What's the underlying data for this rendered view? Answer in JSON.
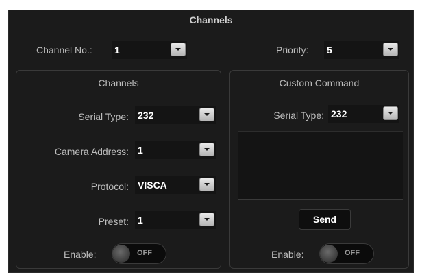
{
  "window": {
    "title": "Channels"
  },
  "top": {
    "channel_no": {
      "label": "Channel No.:",
      "value": "1"
    },
    "priority": {
      "label": "Priority:",
      "value": "5"
    }
  },
  "left_panel": {
    "title": "Channels",
    "serial_type": {
      "label": "Serial Type:",
      "value": "232"
    },
    "camera_address": {
      "label": "Camera Address:",
      "value": "1"
    },
    "protocol": {
      "label": "Protocol:",
      "value": "VISCA"
    },
    "preset": {
      "label": "Preset:",
      "value": "1"
    },
    "enable": {
      "label": "Enable:",
      "state": "OFF"
    }
  },
  "right_panel": {
    "title": "Custom Command",
    "serial_type": {
      "label": "Serial Type:",
      "value": "232"
    },
    "command_text": "",
    "send_label": "Send",
    "enable": {
      "label": "Enable:",
      "state": "OFF"
    }
  },
  "colors": {
    "background": "#1b1b1b",
    "field": "#141414",
    "text": "#bdbdbd",
    "value": "#ffffff"
  }
}
